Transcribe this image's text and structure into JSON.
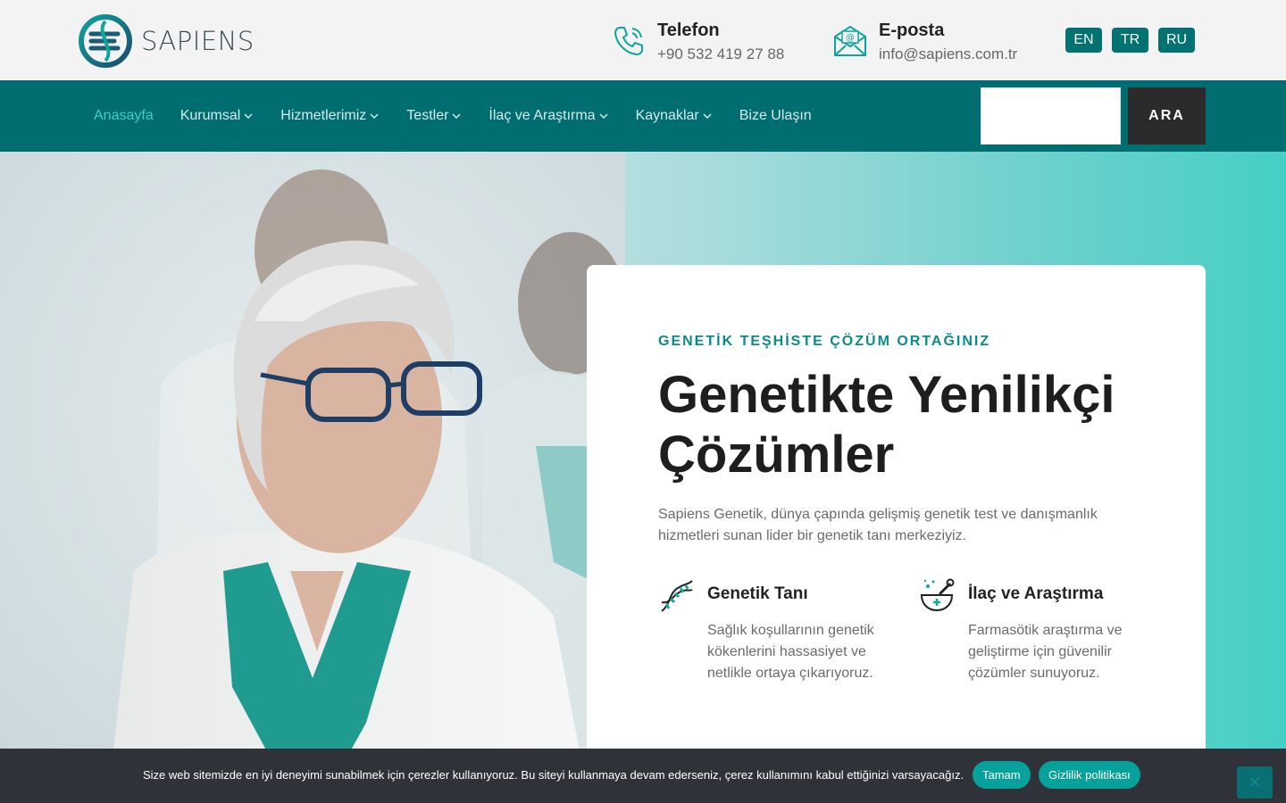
{
  "brand": {
    "name": "SAPIENS"
  },
  "contact": {
    "phone": {
      "title": "Telefon",
      "value": "+90 532 419 27 88",
      "icon": "phone-icon"
    },
    "email": {
      "title": "E-posta",
      "value": "info@sapiens.com.tr",
      "icon": "envelope-icon"
    }
  },
  "languages": [
    "EN",
    "TR",
    "RU"
  ],
  "nav": {
    "items": [
      {
        "label": "Anasayfa",
        "active": true,
        "dropdown": false
      },
      {
        "label": "Kurumsal",
        "active": false,
        "dropdown": true
      },
      {
        "label": "Hizmetlerimiz",
        "active": false,
        "dropdown": true
      },
      {
        "label": "Testler",
        "active": false,
        "dropdown": true
      },
      {
        "label": "İlaç ve Araştırma",
        "active": false,
        "dropdown": true
      },
      {
        "label": "Kaynaklar",
        "active": false,
        "dropdown": true
      },
      {
        "label": "Bize Ulaşın",
        "active": false,
        "dropdown": false
      }
    ],
    "search_placeholder": "",
    "search_button": "ARA"
  },
  "hero": {
    "kicker": "GENETİK TEŞHİSTE ÇÖZÜM ORTAĞINIZ",
    "headline": "Genetikte Yenilikçi Çözümler",
    "lead": "Sapiens Genetik, dünya çapında gelişmiş genetik test ve danışmanlık hizmetleri sunan lider bir genetik tanı merkeziyiz.",
    "features": [
      {
        "title": "Genetik Tanı",
        "desc": "Sağlık koşullarının genetik kökenlerini hassasiyet ve netlikle ortaya çıkarıyoruz.",
        "icon": "dna-icon"
      },
      {
        "title": "İlaç ve Araştırma",
        "desc": "Farmasötik araştırma ve geliştirme için güvenilir çözümler sunuyoruz.",
        "icon": "mortar-pestle-icon"
      }
    ]
  },
  "cookie": {
    "text": "Size web sitemizde en iyi deneyimi sunabilmek için çerezler kullanıyoruz. Bu siteyi kullanmaya devam ederseniz, çerez kullanımını kabul ettiğinizi varsayacağız.",
    "ok_label": "Tamam",
    "privacy_label": "Gizlilik politikası"
  },
  "colors": {
    "primary": "#006d70",
    "accent": "#0b8a8a",
    "active_nav": "#3dcfc5",
    "dark": "#2b2b2b"
  }
}
